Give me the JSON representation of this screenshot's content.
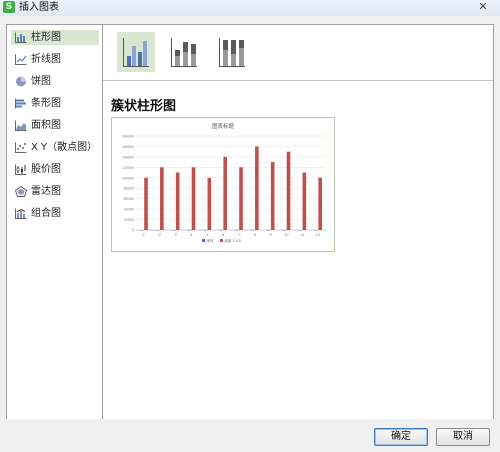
{
  "window": {
    "title": "插入图表",
    "app_icon_glyph": "S",
    "close_glyph": "✕"
  },
  "sidebar": {
    "items": [
      {
        "label": "柱形图",
        "icon": "column-chart-icon",
        "selected": true
      },
      {
        "label": "折线图",
        "icon": "line-chart-icon"
      },
      {
        "label": "饼图",
        "icon": "pie-chart-icon"
      },
      {
        "label": "条形图",
        "icon": "bar-chart-icon"
      },
      {
        "label": "面积图",
        "icon": "area-chart-icon"
      },
      {
        "label": "X Y（散点图）",
        "icon": "scatter-chart-icon"
      },
      {
        "label": "股价图",
        "icon": "stock-chart-icon"
      },
      {
        "label": "雷达图",
        "icon": "radar-chart-icon"
      },
      {
        "label": "组合图",
        "icon": "combo-chart-icon"
      }
    ]
  },
  "subtypes": [
    {
      "name": "clustered-column",
      "selected": true
    },
    {
      "name": "stacked-column"
    },
    {
      "name": "percent-stacked-column"
    }
  ],
  "preview": {
    "heading": "簇状柱形图",
    "colors": {
      "series1": "#4f6fb5",
      "series2": "#c0504d",
      "grid": "#e3e3e3"
    }
  },
  "chart_data": {
    "type": "bar",
    "title": "图表标题",
    "categories": [
      "1",
      "2",
      "3",
      "4",
      "5",
      "6",
      "7",
      "8",
      "9",
      "10",
      "11",
      "12"
    ],
    "series": [
      {
        "values": [
          20,
          30,
          25,
          35,
          20,
          40,
          30,
          50,
          40,
          45,
          25,
          20
        ]
      },
      {
        "values": [
          100000,
          120000,
          110000,
          120000,
          100000,
          140000,
          120000,
          160000,
          130000,
          150000,
          110000,
          100000
        ]
      }
    ],
    "yticks": [
      "0",
      "20000",
      "40000",
      "60000",
      "80000",
      "100000",
      "120000",
      "140000",
      "160000",
      "180000"
    ],
    "ylim": [
      0,
      180000
    ],
    "legend": {
      "position": "bottom",
      "labels": [
        "序列",
        "品鉴 1.0.0"
      ]
    }
  },
  "footer": {
    "ok_label": "确定",
    "cancel_label": "取消"
  }
}
